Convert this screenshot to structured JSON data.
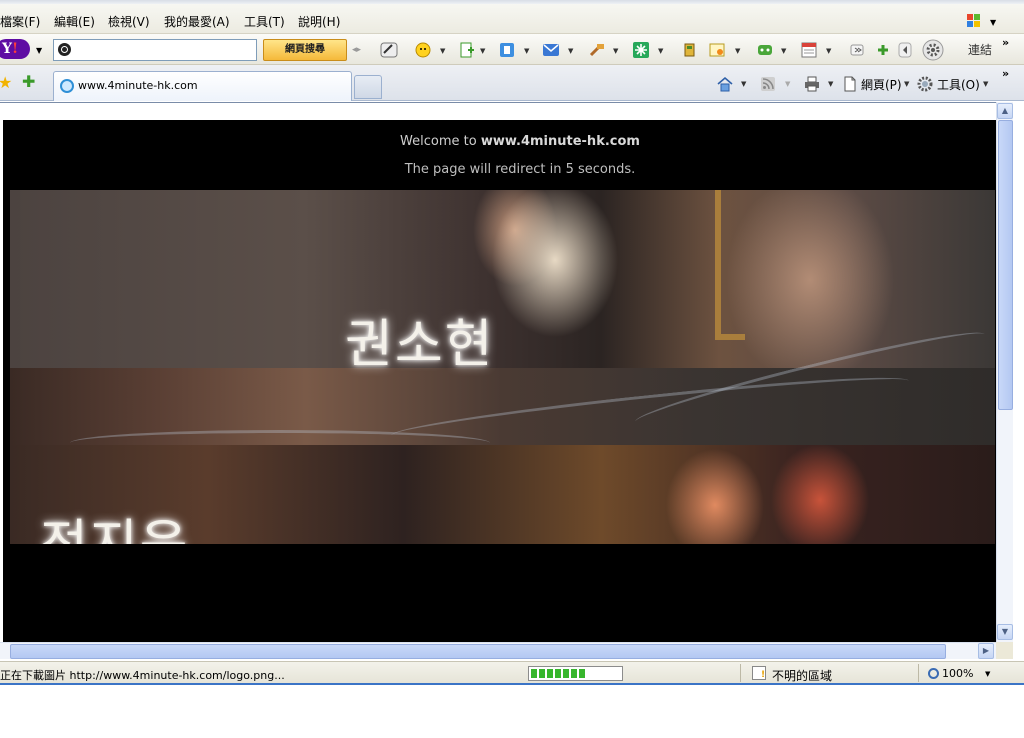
{
  "menubar": {
    "items": [
      "檔案(F)",
      "編輯(E)",
      "檢視(V)",
      "我的最愛(A)",
      "工具(T)",
      "說明(H)"
    ]
  },
  "yahoo_toolbar": {
    "logo": "Y!",
    "search_value": "",
    "search_button": "網頁搜尋",
    "links_label": "連結",
    "chevron": "»"
  },
  "tabs": {
    "active_title": "www.4minute-hk.com"
  },
  "command_bar": {
    "page_label": "網頁(P)",
    "tools_label": "工具(O)",
    "chevron": "»"
  },
  "page": {
    "welcome_prefix": "Welcome to ",
    "welcome_site": "www.4minute-hk.com",
    "redirect_text": "The page will redirect in 5 seconds.",
    "banner_name_1": "권소현",
    "banner_name_2": "전지윤"
  },
  "statusbar": {
    "status_text": "正在下載圖片 http://www.4minute-hk.com/logo.png...",
    "progress_fraction": 0.6,
    "zone_text": "不明的區域",
    "zoom_text": "100%"
  },
  "colors": {
    "page_background": "#000000",
    "status_accent": "#3b74c6",
    "progress_fill": "#37b62d"
  }
}
